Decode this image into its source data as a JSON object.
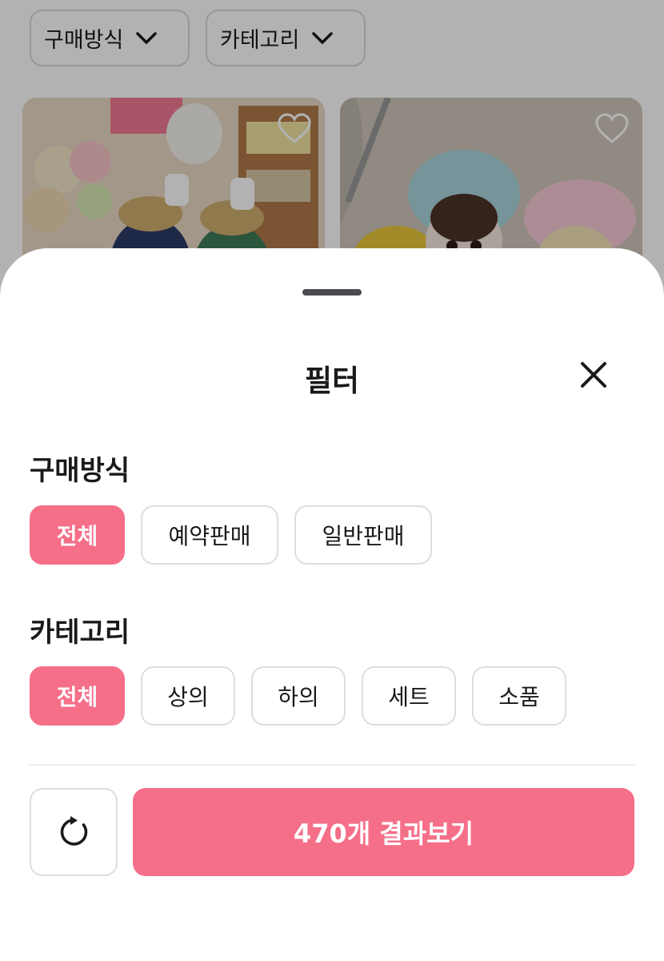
{
  "background": {
    "filters": [
      {
        "label": "구매방식",
        "icon": "chevron-down-icon"
      },
      {
        "label": "카테고리",
        "icon": "chevron-down-icon"
      }
    ],
    "cards": [
      {
        "icon": "heart-outline-icon"
      },
      {
        "icon": "heart-outline-icon"
      }
    ]
  },
  "sheet": {
    "title": "필터",
    "close_icon": "close-icon",
    "sections": [
      {
        "title": "구매방식",
        "options": [
          "전체",
          "예약판매",
          "일반판매"
        ],
        "selected": "전체"
      },
      {
        "title": "카테고리",
        "options": [
          "전체",
          "상의",
          "하의",
          "세트",
          "소품"
        ],
        "selected": "전체"
      }
    ],
    "reset_icon": "refresh-icon",
    "submit_label": "470개 결과보기"
  },
  "colors": {
    "accent": "#f56f89",
    "chip_border": "#dedede",
    "text": "#1a1a1a"
  }
}
